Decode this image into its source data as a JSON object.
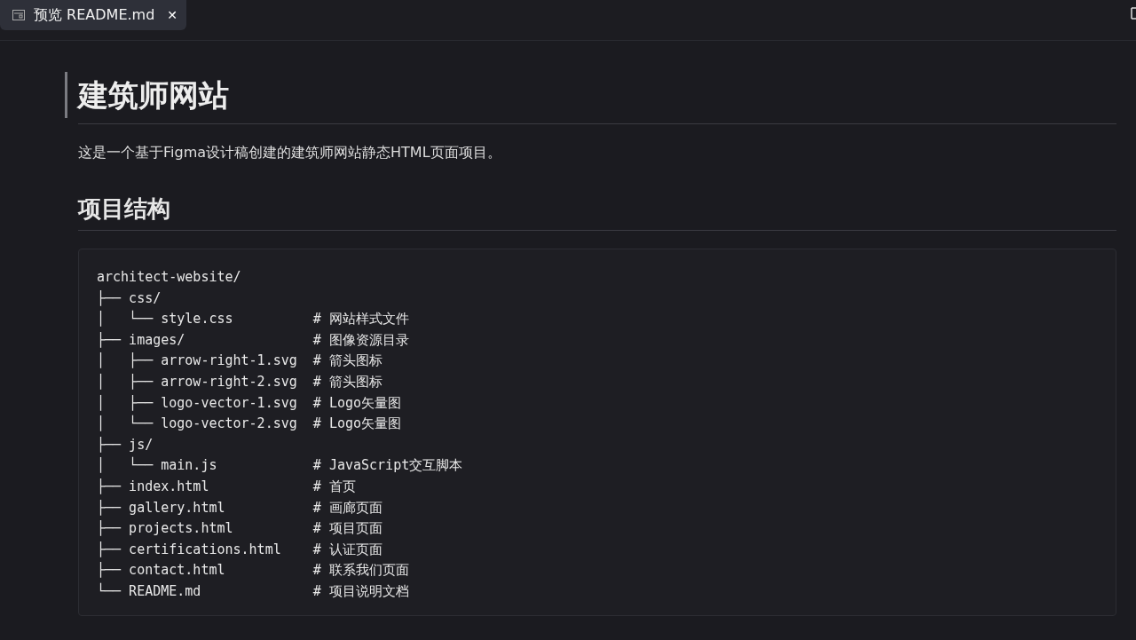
{
  "tabs": [
    {
      "label": "预览 README.md",
      "selected": true,
      "close": "✕"
    }
  ],
  "document": {
    "title": "建筑师网站",
    "intro": "这是一个基于Figma设计稿创建的建筑师网站静态HTML页面项目。",
    "section_heading": "项目结构",
    "code_lines": [
      "architect-website/",
      "├── css/",
      "│   └── style.css          # 网站样式文件",
      "├── images/                # 图像资源目录",
      "│   ├── arrow-right-1.svg  # 箭头图标",
      "│   ├── arrow-right-2.svg  # 箭头图标",
      "│   ├── logo-vector-1.svg  # Logo矢量图",
      "│   └── logo-vector-2.svg  # Logo矢量图",
      "├── js/",
      "│   └── main.js            # JavaScript交互脚本",
      "├── index.html             # 首页",
      "├── gallery.html           # 画廊页面",
      "├── projects.html          # 项目页面",
      "├── certifications.html    # 认证页面",
      "├── contact.html           # 联系我们页面",
      "└── README.md              # 项目说明文档"
    ]
  }
}
